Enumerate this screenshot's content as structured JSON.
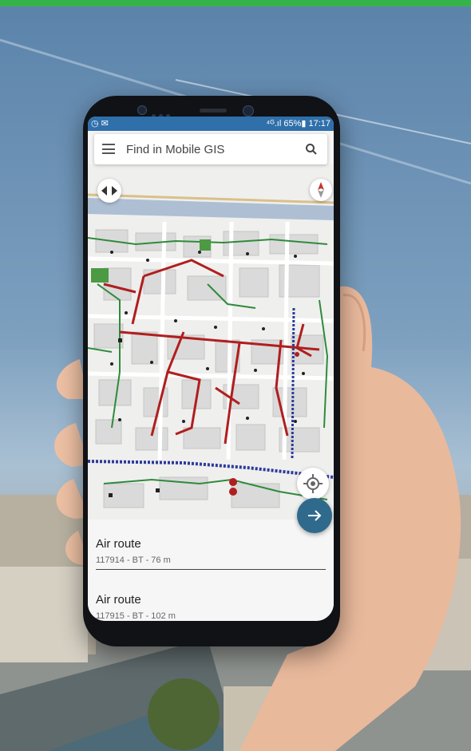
{
  "status_bar": {
    "left_icons": [
      "circle-icon",
      "mail-icon"
    ],
    "right_text": "⁴ᴳ.ıl 65%▮ 17:17"
  },
  "search": {
    "placeholder": "Find in Mobile GIS",
    "menu_icon": "hamburger-menu-icon",
    "search_icon": "search-icon"
  },
  "map_controls": {
    "pan_icon": "pan-arrows-icon",
    "compass_icon": "compass-icon",
    "locate_icon": "my-location-icon",
    "fab_icon": "arrow-right-icon"
  },
  "results": [
    {
      "title": "Air route",
      "subtitle": "117914 - BT - 76 m"
    },
    {
      "title": "Air route",
      "subtitle": "117915 - BT - 102 m"
    }
  ],
  "colors": {
    "accent": "#2f6a8d",
    "status_bar": "#2f6faa",
    "network_red": "#b01e1e",
    "network_green": "#2e8b3a",
    "top_bar_green": "#35b34a"
  }
}
